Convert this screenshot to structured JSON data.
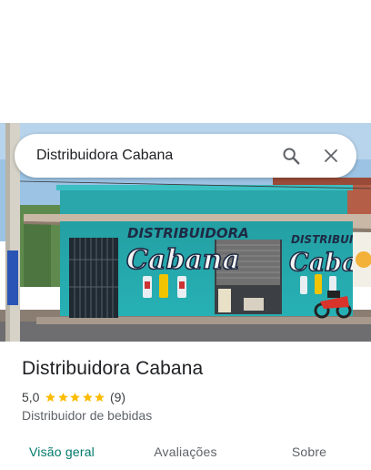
{
  "search": {
    "query": "Distribuidora Cabana"
  },
  "icons": {
    "search": "search-icon",
    "clear": "close-icon",
    "star": "star-icon"
  },
  "photo": {
    "sign_top_word": "DISTRIBUIDORA",
    "sign_script_word": "Cabana"
  },
  "place": {
    "name": "Distribuidora Cabana",
    "rating": "5,0",
    "stars_filled": 5,
    "reviews_count": "(9)",
    "category": "Distribuidor de bebidas"
  },
  "tabs": [
    {
      "label": "Visão geral",
      "active": true
    },
    {
      "label": "Avaliações",
      "active": false
    },
    {
      "label": "Sobre",
      "active": false
    }
  ],
  "colors": {
    "accent": "#00796b",
    "star": "#fbbc04",
    "building": "#2bb5b8"
  }
}
